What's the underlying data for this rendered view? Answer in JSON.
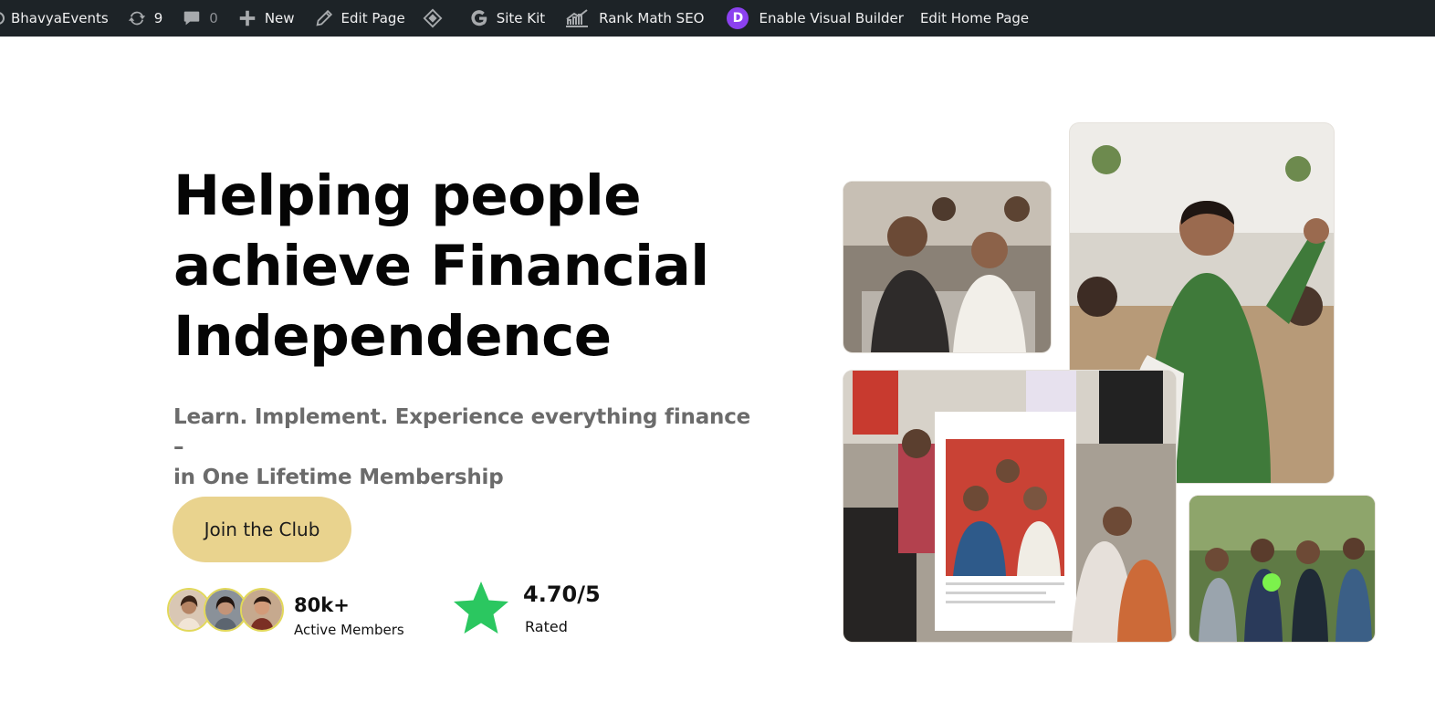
{
  "adminbar": {
    "site_name": "BhavyaEvents",
    "updates_count": "9",
    "comments_count": "0",
    "new_label": "New",
    "edit_page_label": "Edit Page",
    "sitekit_label": "Site Kit",
    "rankmath_label": "Rank Math SEO",
    "divi_letter": "D",
    "visual_builder_label": "Enable Visual Builder",
    "edit_home_label": "Edit Home Page",
    "icons": [
      "wordpress-logo-icon",
      "updates-icon",
      "comments-icon",
      "plus-icon",
      "pencil-icon",
      "diamond-icon",
      "google-g-icon",
      "rank-math-icon",
      "divi-icon"
    ]
  },
  "hero": {
    "title_line1": "Helping people",
    "title_line2": "achieve Financial",
    "title_line3": "Independence",
    "subtitle_line1": "Learn. Implement. Experience everything finance –",
    "subtitle_line2": "in One Lifetime Membership",
    "cta_label": "Join the Club"
  },
  "stats": {
    "members_value": "80k+",
    "members_label": "Active Members",
    "rating_value": "4.70/5",
    "rating_label": "Rated"
  },
  "colors": {
    "adminbar_bg": "#1d2327",
    "cta_bg": "#e9d38e",
    "star": "#2bc760",
    "divi_purple": "#8c41f0",
    "subtitle": "#6b6b6b"
  }
}
